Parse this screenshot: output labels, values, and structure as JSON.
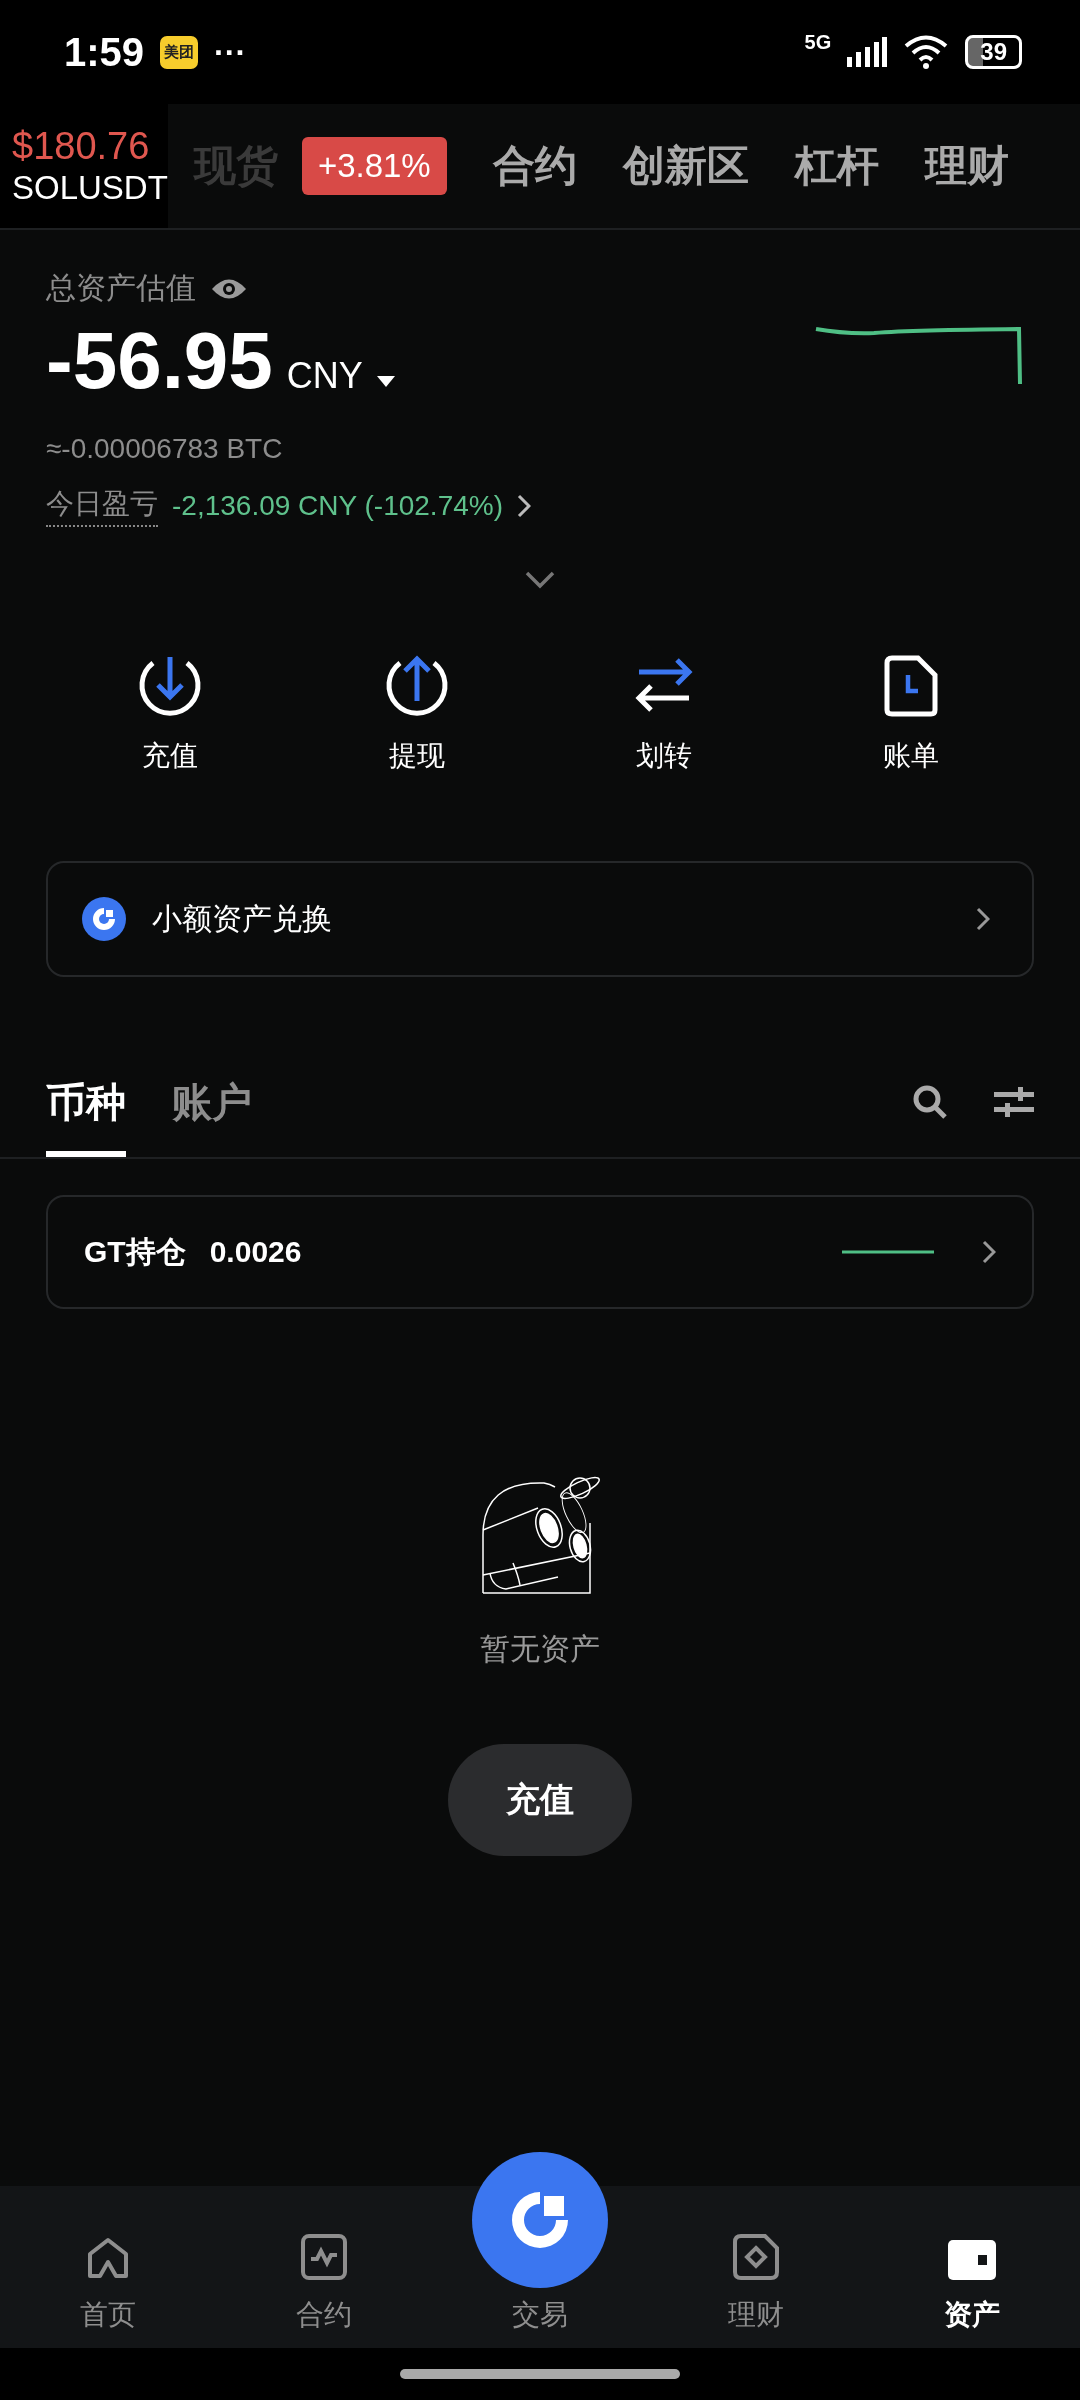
{
  "status_bar": {
    "time": "1:59",
    "app_badge": "美团",
    "more": "···",
    "network": "5G",
    "battery": "39"
  },
  "ticker": {
    "price": "$180.76",
    "symbol": "SOLUSDT",
    "change": "+3.81%"
  },
  "nav_tabs": [
    {
      "label": "现货",
      "kind": "covered"
    },
    {
      "label": "合约",
      "kind": "plain"
    },
    {
      "label": "创新区",
      "kind": "plain"
    },
    {
      "label": "杠杆",
      "kind": "plain"
    },
    {
      "label": "理财",
      "kind": "plain"
    }
  ],
  "asset": {
    "label": "总资产估值",
    "amount": "-56.95",
    "currency": "CNY",
    "btc": "≈-0.00006783 BTC",
    "pnl_label": "今日盈亏",
    "pnl_value": "-2,136.09 CNY (-102.74%)"
  },
  "actions": [
    {
      "label": "充值",
      "kind": "deposit"
    },
    {
      "label": "提现",
      "kind": "withdraw"
    },
    {
      "label": "划转",
      "kind": "transfer"
    },
    {
      "label": "账单",
      "kind": "bill"
    }
  ],
  "promo": {
    "label": "小额资产兑换"
  },
  "list_tabs": [
    {
      "label": "币种",
      "selected": true
    },
    {
      "label": "账户",
      "selected": false
    }
  ],
  "holding": {
    "label": "GT持仓",
    "value": "0.0026"
  },
  "empty": {
    "message": "暂无资产",
    "button": "充值"
  },
  "bottom_nav": [
    {
      "label": "首页",
      "kind": "home",
      "selected": false
    },
    {
      "label": "合约",
      "kind": "chart",
      "selected": false
    },
    {
      "label": "交易",
      "kind": "trade",
      "selected": false
    },
    {
      "label": "理财",
      "kind": "finance",
      "selected": false
    },
    {
      "label": "资产",
      "kind": "wallet",
      "selected": true
    }
  ]
}
